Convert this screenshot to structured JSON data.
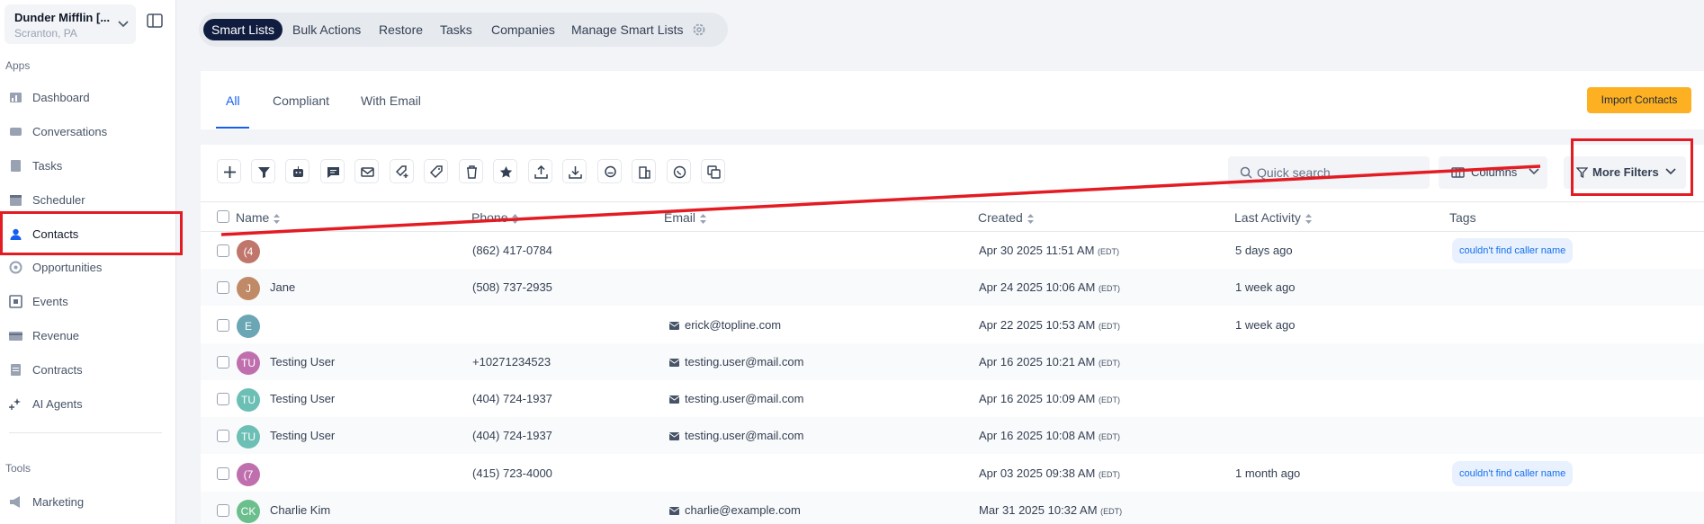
{
  "sidebar": {
    "location_name": "Dunder Mifflin [...",
    "location_sub": "Scranton, PA",
    "apps_label": "Apps",
    "tools_label": "Tools",
    "items": [
      {
        "label": "Dashboard",
        "icon": "dashboard-icon"
      },
      {
        "label": "Conversations",
        "icon": "conversations-icon"
      },
      {
        "label": "Tasks",
        "icon": "tasks-icon"
      },
      {
        "label": "Scheduler",
        "icon": "calendar-icon"
      },
      {
        "label": "Contacts",
        "icon": "contacts-icon"
      },
      {
        "label": "Opportunities",
        "icon": "opportunities-icon"
      },
      {
        "label": "Events",
        "icon": "events-icon"
      },
      {
        "label": "Revenue",
        "icon": "revenue-icon"
      },
      {
        "label": "Contracts",
        "icon": "contracts-icon"
      },
      {
        "label": "AI Agents",
        "icon": "ai-agents-icon"
      }
    ],
    "tools": [
      {
        "label": "Marketing",
        "icon": "megaphone-icon"
      }
    ]
  },
  "top_tabs": [
    "Smart Lists",
    "Bulk Actions",
    "Restore",
    "Tasks",
    "Companies",
    "Manage Smart Lists"
  ],
  "sub_tabs": [
    "All",
    "Compliant",
    "With Email"
  ],
  "import_label": "Import Contacts",
  "toolbar": {
    "search_placeholder": "Quick search",
    "columns_label": "Columns",
    "more_filters_label": "More Filters"
  },
  "table": {
    "headers": {
      "name": "Name",
      "phone": "Phone",
      "email": "Email",
      "created": "Created",
      "last_activity": "Last Activity",
      "tags": "Tags"
    },
    "rows": [
      {
        "initials": "(4",
        "name": "",
        "phone": "(862) 417-0784",
        "email": "",
        "created": "Apr 30 2025 11:51 AM",
        "tz": "(EDT)",
        "last_activity": "5 days ago",
        "tag": "couldn't find caller name",
        "color": "#c0766b"
      },
      {
        "initials": "J",
        "name": "Jane",
        "phone": "(508) 737-2935",
        "email": "",
        "created": "Apr 24 2025 10:06 AM",
        "tz": "(EDT)",
        "last_activity": "1 week ago",
        "tag": "",
        "color": "#c08a66"
      },
      {
        "initials": "E",
        "name": "",
        "phone": "",
        "email": "erick@topline.com",
        "created": "Apr 22 2025 10:53 AM",
        "tz": "(EDT)",
        "last_activity": "1 week ago",
        "tag": "",
        "color": "#6aa6b4"
      },
      {
        "initials": "TU",
        "name": "Testing User",
        "phone": "+10271234523",
        "email": "testing.user@mail.com",
        "created": "Apr 16 2025 10:21 AM",
        "tz": "(EDT)",
        "last_activity": "",
        "tag": "",
        "color": "#c06fae"
      },
      {
        "initials": "TU",
        "name": "Testing User",
        "phone": "(404) 724-1937",
        "email": "testing.user@mail.com",
        "created": "Apr 16 2025 10:09 AM",
        "tz": "(EDT)",
        "last_activity": "",
        "tag": "",
        "color": "#6bbfb4"
      },
      {
        "initials": "TU",
        "name": "Testing User",
        "phone": "(404) 724-1937",
        "email": "testing.user@mail.com",
        "created": "Apr 16 2025 10:08 AM",
        "tz": "(EDT)",
        "last_activity": "",
        "tag": "",
        "color": "#6bbfb4"
      },
      {
        "initials": "(7",
        "name": "",
        "phone": "(415) 723-4000",
        "email": "",
        "created": "Apr 03 2025 09:38 AM",
        "tz": "(EDT)",
        "last_activity": "1 month ago",
        "tag": "couldn't find caller name",
        "color": "#c06fae"
      },
      {
        "initials": "CK",
        "name": "Charlie Kim",
        "phone": "",
        "email": "charlie@example.com",
        "created": "Mar 31 2025 10:32 AM",
        "tz": "(EDT)",
        "last_activity": "",
        "tag": "",
        "color": "#6bbf8c"
      }
    ]
  },
  "colors": {
    "accent": "#155eef",
    "import": "#fdb022",
    "active_tab": "#101d3f",
    "annotation": "#e31b23"
  }
}
